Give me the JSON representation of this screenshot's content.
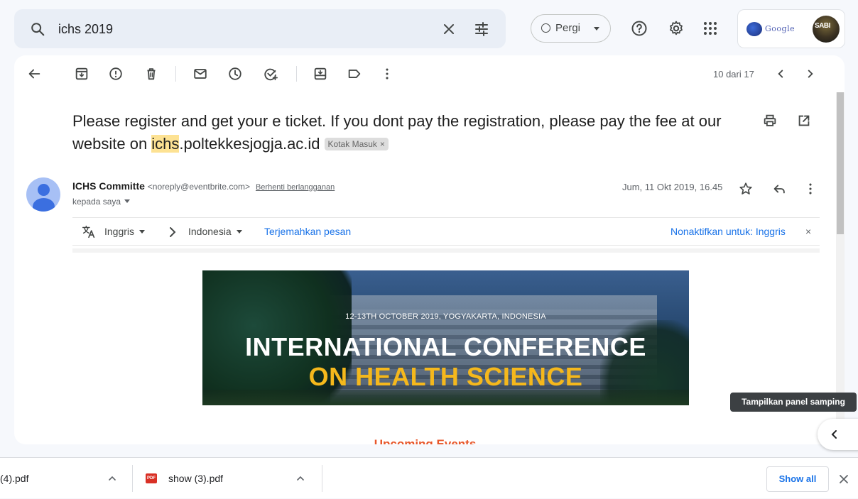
{
  "search": {
    "query": "ichs 2019",
    "icon": "search-icon",
    "clear_icon": "close-icon",
    "filter_icon": "tune-icon"
  },
  "status": {
    "label": "Pergi"
  },
  "header_icons": [
    "help-icon",
    "gear-icon",
    "apps-grid-icon"
  ],
  "account": {
    "org_logo_text": "Google",
    "avatar_text": "SABI"
  },
  "toolbar": {
    "icons": [
      "back-arrow-icon",
      "archive-icon",
      "report-spam-icon",
      "delete-icon",
      "mark-unread-icon",
      "snooze-icon",
      "add-task-icon",
      "move-to-icon",
      "label-icon",
      "more-vert-icon"
    ],
    "pager": "10 dari 17"
  },
  "message": {
    "subject_before": "Please register and get your e ticket. If you dont pay the registration, please pay the fee at our website on ",
    "subject_highlight": "ichs",
    "subject_after": ".poltekkesjogja.ac.id",
    "label": "Kotak Masuk",
    "label_close": "×",
    "sender_name": "ICHS Committe",
    "sender_email": "<noreply@eventbrite.com>",
    "unsubscribe": "Berhenti berlangganan",
    "to": "kepada saya",
    "date": "Jum, 11 Okt 2019, 16.45"
  },
  "translate": {
    "from": "Inggris",
    "to": "Indonesia",
    "action": "Terjemahkan pesan",
    "disable": "Nonaktifkan untuk: Inggris",
    "close": "×"
  },
  "banner": {
    "date": "12-13TH OCTOBER 2019, YOGYAKARTA, INDONESIA",
    "title_line1": "INTERNATIONAL CONFERENCE",
    "title_line2": "ON HEALTH SCIENCE"
  },
  "upcoming": "Upcoming Events",
  "side_panel": {
    "tooltip": "Tampilkan panel samping"
  },
  "downloads": {
    "items": [
      {
        "name": " (4).pdf"
      },
      {
        "name": "show (3).pdf"
      }
    ],
    "pdf_badge": "PDF",
    "show_all": "Show all"
  }
}
